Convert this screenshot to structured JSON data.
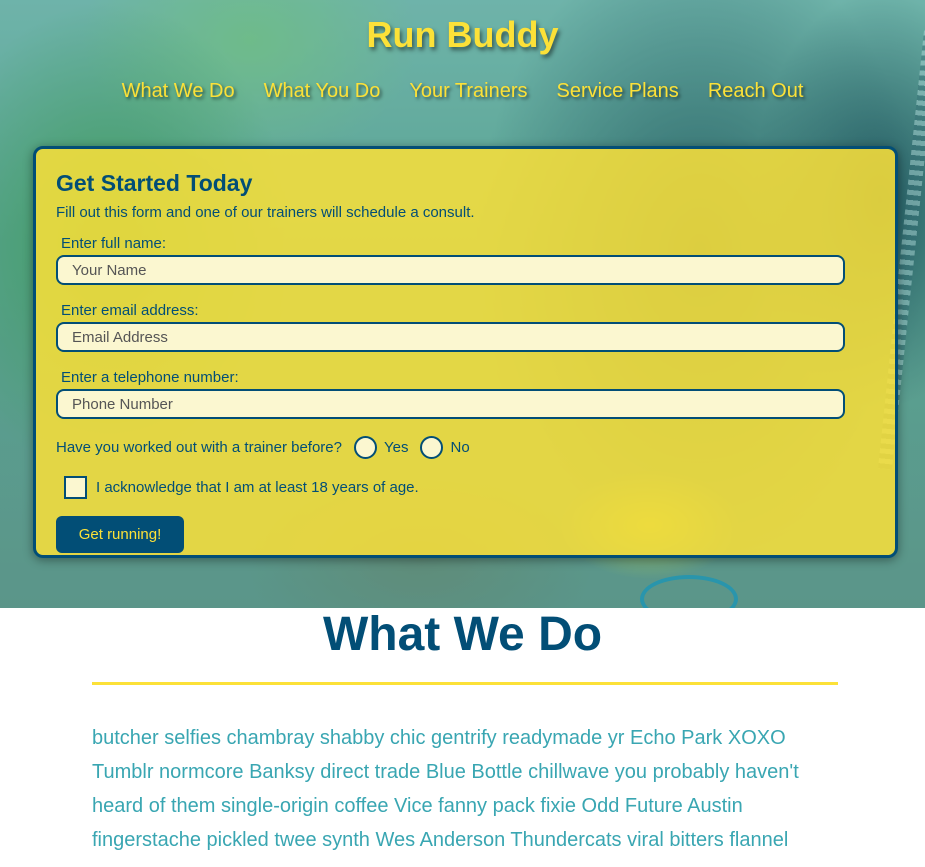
{
  "header": {
    "title": "Run Buddy",
    "nav": [
      "What We Do",
      "What You Do",
      "Your Trainers",
      "Service Plans",
      "Reach Out"
    ]
  },
  "form": {
    "heading": "Get Started Today",
    "intro": "Fill out this form and one of our trainers will schedule a consult.",
    "name_label": "Enter full name:",
    "name_placeholder": "Your Name",
    "name_value": "",
    "email_label": "Enter email address:",
    "email_placeholder": "Email Address",
    "email_value": "",
    "phone_label": "Enter a telephone number:",
    "phone_placeholder": "Phone Number",
    "phone_value": "",
    "trainer_question": "Have you worked out with a trainer before?",
    "yes_label": "Yes",
    "no_label": "No",
    "yes_selected": false,
    "no_selected": false,
    "age_ack_label": "I acknowledge that I am at least 18 years of age.",
    "age_ack_checked": false,
    "submit_label": "Get running!"
  },
  "what_we_do": {
    "heading": "What We Do",
    "body": "butcher selfies chambray shabby chic gentrify readymade yr Echo Park XOXO Tumblr normcore Banksy direct trade Blue Bottle chillwave you probably haven't heard of them single-origin coffee Vice fanny pack fixie Odd Future Austin fingerstache pickled twee synth Wes Anderson Thundercats viral bitters flannel"
  },
  "colors": {
    "brand_yellow": "#fce138",
    "brand_navy": "#024e76",
    "body_teal": "#39a6b2"
  }
}
